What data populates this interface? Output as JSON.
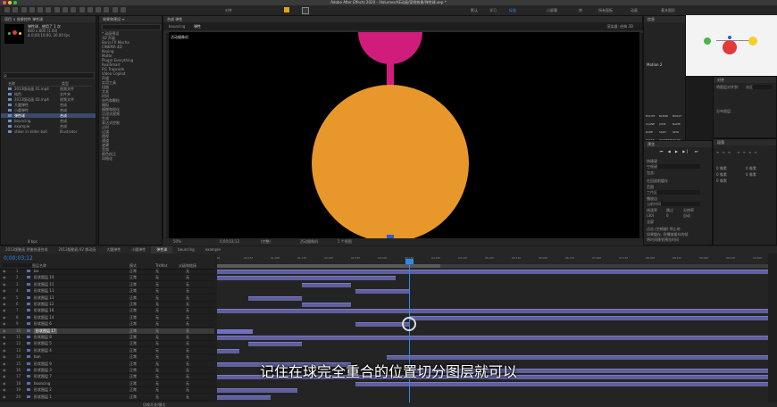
{
  "app": {
    "title": "Adobe After Effects 2020 - /Volumes/AE动画/案例效果/弹性球.aep *"
  },
  "toolbar": {
    "snap_label": "对齐",
    "workspaces": [
      "默认",
      "学习",
      "标准",
      "小屏幕",
      "库",
      "所有面板",
      "动画",
      "基本图形",
      "颜色",
      "效果",
      "运动跟踪"
    ]
  },
  "project": {
    "tab": "项目 × 效果控件 弹性球",
    "comp_name": "弹性球 , 使用了 1 次",
    "comp_info": "800 x 800 (1.00)",
    "comp_duration": "Δ 0;00;10;00, 30.00 fps",
    "search_placeholder": "ρ",
    "col_name": "名称",
    "col_type": "类型",
    "items": [
      {
        "name": "2013版动画 01.mp4",
        "type": "视频文件"
      },
      {
        "name": "纯色",
        "type": "文件夹"
      },
      {
        "name": "2013版动画 02.mp4",
        "type": "视频文件"
      },
      {
        "name": "大圆弹性",
        "type": "合成"
      },
      {
        "name": "小圆弹性",
        "type": "合成"
      },
      {
        "name": "弹性球",
        "type": "合成"
      },
      {
        "name": "bouncing",
        "type": "合成"
      },
      {
        "name": "example",
        "type": "合成"
      },
      {
        "name": "stiker in slider ball",
        "type": "Illustrator"
      }
    ],
    "bpc": "8 bpc"
  },
  "effects_presets": {
    "tab": "效果和预设 ≡",
    "items": [
      "* 动画预设",
      "3D 声道",
      "Boris FX Mocha",
      "CINEMA 4D",
      "Keying",
      "Matte",
      "Plugin Everything",
      "RealSmart",
      "RG Trapcode",
      "Video Copilot",
      "声道",
      "实用工具",
      "扭曲",
      "文本",
      "时间",
      "杂色和颗粒",
      "模拟",
      "模糊和锐化",
      "沉浸式视频",
      "生成",
      "表达式控制",
      "过时",
      "过渡",
      "透视",
      "通道",
      "遮罩",
      "音频",
      "颜色校正",
      "风格化"
    ]
  },
  "composition": {
    "tab": "合成 弹性",
    "subtabs": [
      "bouncing",
      "弹性"
    ],
    "label": "活动摄像机",
    "renderer": "渲染器: 经典 3D",
    "zoom": "50%",
    "timecode": "0;00;03;12",
    "quality": "(完整)",
    "view": "活动摄像机",
    "views": "1 个视图"
  },
  "effects_panel": {
    "tab": "信息",
    "section": "Motion 2",
    "buttons": [
      "EXCITE",
      "BLEND",
      "BURST",
      "CLONE",
      "JUMP",
      "NAME",
      "ROPE",
      "SORT",
      "SPIN",
      "STARE",
      "VIGNETTE",
      "WARP"
    ]
  },
  "preview_panel": {
    "tab": "预览",
    "shortcut_label": "快捷键",
    "shortcut_value": "空格键",
    "include": "包含:",
    "cache": "在回放前缓存",
    "range_label": "范围",
    "range_value": "工作区",
    "play_label": "播放自",
    "play_value": "当前时间",
    "fps_label": "帧速率",
    "skip_label": "跳过",
    "res_label": "分辨率",
    "fps_value": "(30)",
    "skip_value": "0",
    "res_value": "自动",
    "fullscreen": "全屏",
    "stop_label": "点击 (空格键) 停止时:",
    "stop_opt1": "如果缓存, 则播放缓存的帧",
    "stop_opt2": "将时间移到预览时间"
  },
  "align_panel": {
    "tab": "对齐",
    "align_to": "将图层对齐到:",
    "align_value": "选区",
    "distribute": "分布图层:"
  },
  "paragraph_panel": {
    "tab": "段落",
    "indent_values": [
      "0 像素",
      "0 像素",
      "0 像素",
      "0 像素",
      "0 像素"
    ]
  },
  "timeline": {
    "tabs": [
      "2013版動画 然後快速合成",
      "2013版動画 02 换动画",
      "大圆弹性",
      "小圆弹性",
      "弹性球",
      "bouncing",
      "example"
    ],
    "timecode": "0;00;03;12",
    "col_source": "图层名称",
    "col_mode": "模式",
    "col_trkmat": "TrkMat",
    "col_parent": "父级和链接",
    "mode_value": "正常",
    "trk_value": "无",
    "parent_value": "无",
    "ruler": [
      "0f",
      "00:15f",
      "01:00f",
      "01:15f",
      "02:00f",
      "02:15f",
      "03:00f",
      "03:15f",
      "04:00f",
      "04:15f",
      "05:00f",
      "05:15f",
      "06:00f",
      "06:15f",
      "07:00f",
      "07:15f",
      "08:00f",
      "08:15f",
      "09:00f",
      "09:15f",
      "10:00f"
    ],
    "layers": [
      {
        "num": "1",
        "name": "ba"
      },
      {
        "num": "2",
        "name": "形状图层 10"
      },
      {
        "num": "3",
        "name": "形状图层 15"
      },
      {
        "num": "4",
        "name": "形状图层 11"
      },
      {
        "num": "5",
        "name": "形状图层 13"
      },
      {
        "num": "6",
        "name": "形状图层 12"
      },
      {
        "num": "7",
        "name": "形状图层 16"
      },
      {
        "num": "8",
        "name": "形状图层 14"
      },
      {
        "num": "9",
        "name": "形状图层 6"
      },
      {
        "num": "10",
        "name": "形状图层 17"
      },
      {
        "num": "11",
        "name": "形状图层 8"
      },
      {
        "num": "12",
        "name": "形状图层 5"
      },
      {
        "num": "13",
        "name": "形状图层 4"
      },
      {
        "num": "14",
        "name": "ban"
      },
      {
        "num": "15",
        "name": "形状图层 9"
      },
      {
        "num": "16",
        "name": "形状图层 3"
      },
      {
        "num": "17",
        "name": "形状图层 7"
      },
      {
        "num": "18",
        "name": "bouncing"
      },
      {
        "num": "19",
        "name": "形状图层 2"
      },
      {
        "num": "20",
        "name": "形状图层 1"
      }
    ],
    "footer": "切换开关/模式"
  },
  "subtitle": "记住在球完全重合的位置切分图层就可以",
  "colors": {
    "orange_ball": "#E8982A",
    "pink_ball": "#D21C7C",
    "blue_dot": "#2F5CC9",
    "green_dot": "#49B549",
    "yellow_dot": "#F1D127",
    "red_dot": "#E03A3A",
    "accent": "#2D8CEB"
  }
}
